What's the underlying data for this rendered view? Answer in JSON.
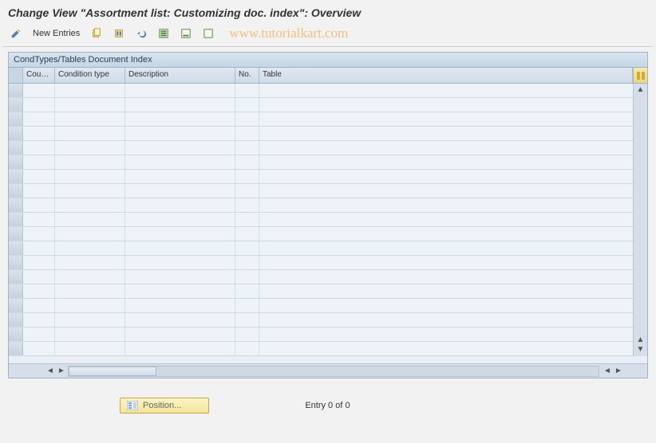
{
  "title": "Change View \"Assortment list: Customizing doc. index\": Overview",
  "toolbar": {
    "new_entries_label": "New Entries"
  },
  "watermark": "www.tutorialkart.com",
  "panel": {
    "title": "CondTypes/Tables Document Index",
    "columns": {
      "coun": "Coun...",
      "cond": "Condition type",
      "desc": "Description",
      "no": "No.",
      "table": "Table"
    },
    "rows": []
  },
  "footer": {
    "position_label": "Position...",
    "entry_status": "Entry 0 of 0"
  }
}
